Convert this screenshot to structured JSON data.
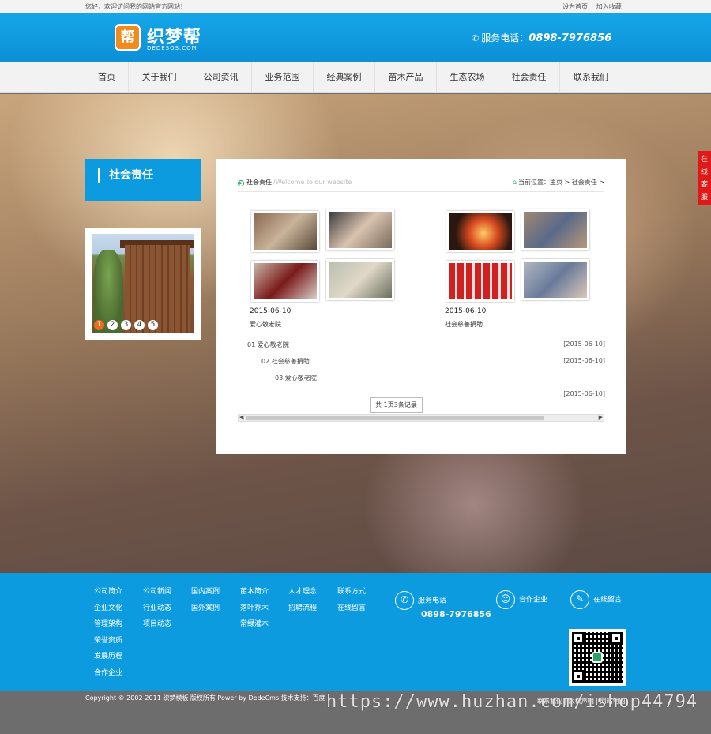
{
  "topbar": {
    "welcome": "您好，欢迎访问我的网站官方网站！",
    "set_home": "设为首页",
    "separator": "|",
    "bookmark": "加入收藏"
  },
  "header": {
    "logo_badge": "帮",
    "logo_text": "织梦帮",
    "logo_sub": "DEDESOS.COM",
    "hotline_label": "服务电话：",
    "hotline_number": "0898-7976856"
  },
  "nav": [
    "首页",
    "关于我们",
    "公司资讯",
    "业务范围",
    "经典案例",
    "苗木产品",
    "生态农场",
    "社会责任",
    "联系我们"
  ],
  "sidebar": {
    "title": "社会责任",
    "slider_dots": [
      "1",
      "2",
      "3",
      "4",
      "5"
    ]
  },
  "main": {
    "section_title": "社会责任",
    "section_sub": "/Welcome to our website",
    "crumb_prefix": "当前位置：",
    "crumb_home": "主页",
    "crumb_sep": ">",
    "crumb_current": "社会责任",
    "cards": [
      {
        "date": "2015-06-10",
        "name": "爱心敬老院"
      },
      {
        "date": "2015-06-10",
        "name": "社会慈善捐助"
      }
    ],
    "list": [
      {
        "title": "01 爱心敬老院",
        "date": "[2015-06-10]"
      },
      {
        "title": "02 社会慈善捐助",
        "date": "[2015-06-10]"
      },
      {
        "title": "03 爱心敬老院",
        "date": ""
      },
      {
        "title": "",
        "date": "[2015-06-10]"
      }
    ],
    "pager": "共 1页3条记录"
  },
  "online_service": [
    "在",
    "线",
    "客",
    "服"
  ],
  "footer": {
    "columns": [
      [
        "公司简介",
        "企业文化",
        "管理架构",
        "荣誉资质",
        "发展历程",
        "合作企业"
      ],
      [
        "公司新闻",
        "行业动态",
        "项目动态"
      ],
      [
        "国内案例",
        "国外案例"
      ],
      [
        "苗木简介",
        "落叶乔木",
        "常绿灌木"
      ],
      [
        "人才理念",
        "招聘流程"
      ],
      [
        "联系方式",
        "在线留言"
      ]
    ],
    "service_label": "服务电话",
    "service_number": "0898-7976856",
    "partner_label": "合作企业",
    "message_label": "在线留言",
    "copyright": "Copyright © 2002-2011 织梦模板 版权所有 Power by DedeCms 技术支持：百度",
    "copyright_right": "联系我们 | 版权声明 | 网站地图"
  },
  "watermark": "https://www.huzhan.com/ishop44794"
}
